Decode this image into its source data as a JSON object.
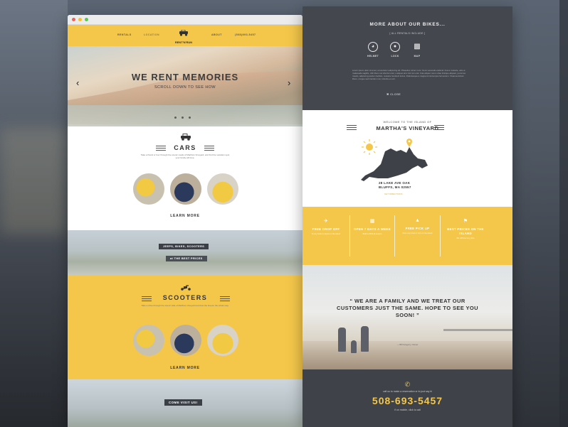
{
  "brand": {
    "logo_text": "RENT'N'RUN"
  },
  "nav": {
    "items": [
      "RENTALS",
      "LOCATION",
      "ABOUT",
      "(508)693-5457"
    ]
  },
  "hero": {
    "title": "WE RENT MEMORIES",
    "subtitle": "SCROLL DOWN TO SEE HOW",
    "slides_count": 3
  },
  "cars": {
    "title": "CARS",
    "description": "Take a friend or four through the scenic roads of Martha's Vineyard, and find the vacation spot your family will love.",
    "cta": "LEARN MORE"
  },
  "band1": {
    "ribbon_top": "JEEPS, BIKES, SCOOTERS",
    "ribbon_bottom": "at THE BEST PRICES"
  },
  "scooters": {
    "title": "SCOOTERS",
    "description": "Take a drive through the scenic side of Martha's Vineyard and feel the breeze the whole way.",
    "cta": "LEARN MORE"
  },
  "visit": {
    "ribbon": "COME VISIT US!"
  },
  "more": {
    "title": "MORE ABOUT OUR BIKES...",
    "included": "[ ALL RENTALS INCLUDE ]",
    "features": [
      {
        "icon": "helmet-icon",
        "label": "HELMET"
      },
      {
        "icon": "lock-icon",
        "label": "LOCK"
      },
      {
        "icon": "map-icon",
        "label": "MAP"
      }
    ],
    "lorem": "Lorem ipsum dolor sit amet, consectetur adipiscing elit. Phasellus rutrum nunc. Nunc venenatis eleifend. Fusce molestie, odio ut malesuada sagittis, nibh libero vel lobortis tortor, a aliquet arcu nisl non erat. Cras aliquet, lorem vitae tristique aliquam, purus leo mauris, adipiscing pretium facilisis, molestie hendrerit luctus. Pellentesque a magna id nisl tempus fermentum. Vivamus dictum libero, congue sed interdum non, lobortis eu orci.",
    "close": "CLOSE"
  },
  "location": {
    "welcome": "WELCOME TO THE ISLAND OF",
    "island": "MARTHA'S VINEYARD",
    "address_line1": "28 LAKE AVE OAK",
    "address_line2": "BLUFFS, MA 02557",
    "directions": "GET DIRECTIONS"
  },
  "perks": [
    {
      "icon": "plane-icon",
      "title": "FREE DROP OFF",
      "sub": "To any hotel or airport on the island"
    },
    {
      "icon": "calendar-icon",
      "title": "OPEN 7 DAYS A WEEK",
      "sub": "8AM to 8PM all season"
    },
    {
      "icon": "car-icon",
      "title": "FREE PICK UP",
      "sub": "From any hotel or ferry on the island"
    },
    {
      "icon": "price-tag-icon",
      "title": "BEST PRICES ON THE ISLAND",
      "sub": "We will beat any price"
    }
  ],
  "testimonial": {
    "quote": "“ WE ARE A FAMILY AND WE TREAT OUR CUSTOMERS JUST THE SAME. HOPE TO SEE YOU SOON! ”",
    "author": "— Bill Gregory, Owner"
  },
  "contact": {
    "call_text": "call us to make a reservation or to just say hi",
    "phone": "508-693-5457",
    "mobile_text": "if on mobile, click to call"
  },
  "colors": {
    "accent": "#f4c74a",
    "dark": "#44474e"
  }
}
